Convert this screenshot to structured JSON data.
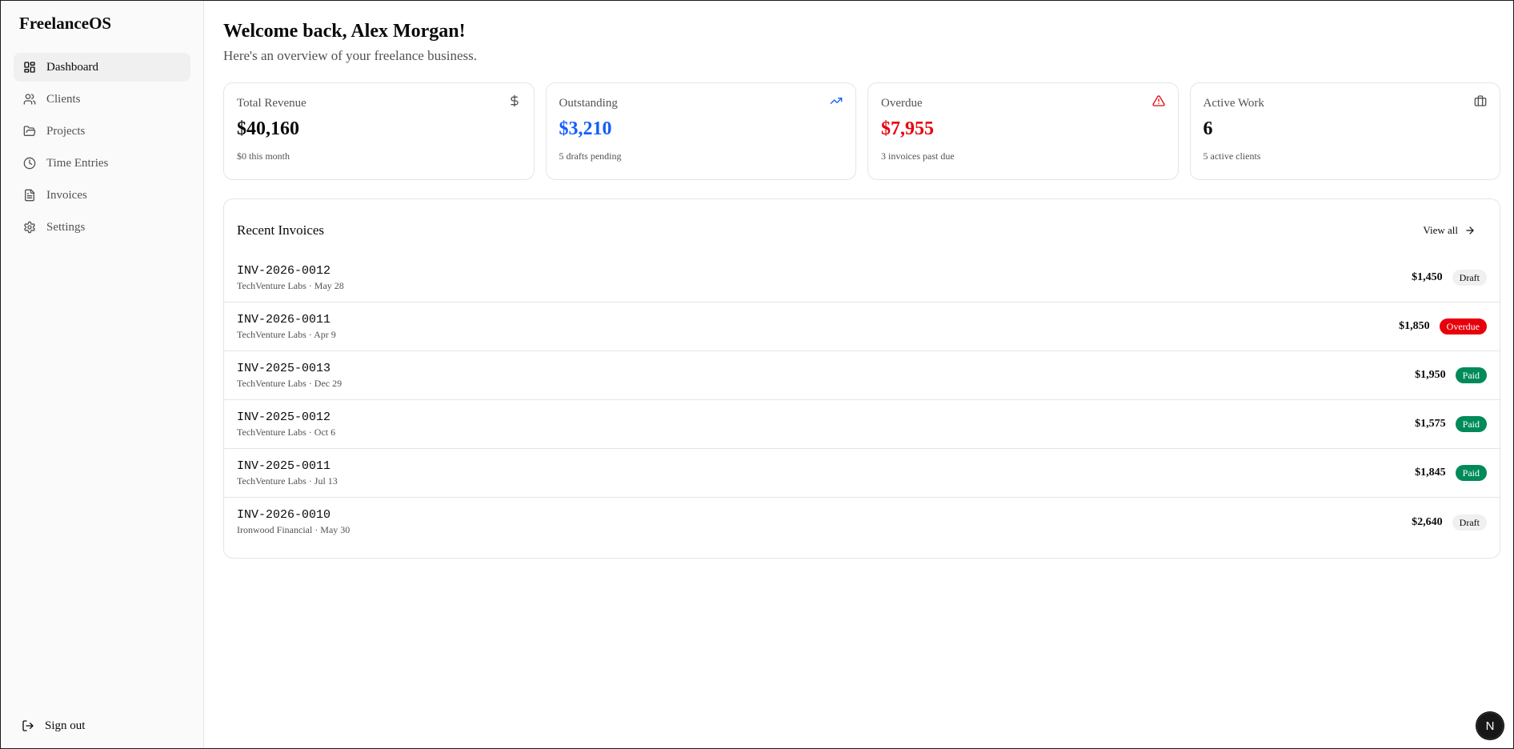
{
  "app": {
    "brand": "FreelanceOS"
  },
  "sidebar": {
    "items": [
      {
        "label": "Dashboard",
        "icon": "layout-grid-icon",
        "active": true
      },
      {
        "label": "Clients",
        "icon": "users-icon"
      },
      {
        "label": "Projects",
        "icon": "folder-icon"
      },
      {
        "label": "Time Entries",
        "icon": "clock-icon"
      },
      {
        "label": "Invoices",
        "icon": "file-text-icon"
      },
      {
        "label": "Settings",
        "icon": "gear-icon"
      }
    ],
    "signout_label": "Sign out"
  },
  "header": {
    "title": "Welcome back, Alex Morgan!",
    "subtitle": "Here's an overview of your freelance business."
  },
  "stats": [
    {
      "label": "Total Revenue",
      "value": "$40,160",
      "sub": "$0 this month",
      "icon": "dollar-icon",
      "color": "#0a0a0a"
    },
    {
      "label": "Outstanding",
      "value": "$3,210",
      "sub": "5 drafts pending",
      "icon": "trending-up-icon",
      "color": "#155dfc"
    },
    {
      "label": "Overdue",
      "value": "$7,955",
      "sub": "3 invoices past due",
      "icon": "alert-triangle-icon",
      "color": "#e7000b"
    },
    {
      "label": "Active Work",
      "value": "6",
      "sub": "5 active clients",
      "icon": "briefcase-icon",
      "color": "#0a0a0a"
    }
  ],
  "recent_invoices": {
    "title": "Recent Invoices",
    "view_all_label": "View all",
    "rows": [
      {
        "id": "INV-2026-0012",
        "meta": "TechVenture Labs · May 28",
        "amount": "$1,450",
        "status": "Draft"
      },
      {
        "id": "INV-2026-0011",
        "meta": "TechVenture Labs · Apr 9",
        "amount": "$1,850",
        "status": "Overdue"
      },
      {
        "id": "INV-2025-0013",
        "meta": "TechVenture Labs · Dec 29",
        "amount": "$1,950",
        "status": "Paid"
      },
      {
        "id": "INV-2025-0012",
        "meta": "TechVenture Labs · Oct 6",
        "amount": "$1,575",
        "status": "Paid"
      },
      {
        "id": "INV-2025-0011",
        "meta": "TechVenture Labs · Jul 13",
        "amount": "$1,845",
        "status": "Paid"
      },
      {
        "id": "INV-2026-0010",
        "meta": "Ironwood Financial · May 30",
        "amount": "$2,640",
        "status": "Draft"
      }
    ]
  },
  "fab": {
    "label": "N"
  },
  "colors": {
    "paid": "#008a5a",
    "overdue": "#e7000b",
    "draft": "#f0f0f0",
    "outstanding": "#155dfc"
  }
}
